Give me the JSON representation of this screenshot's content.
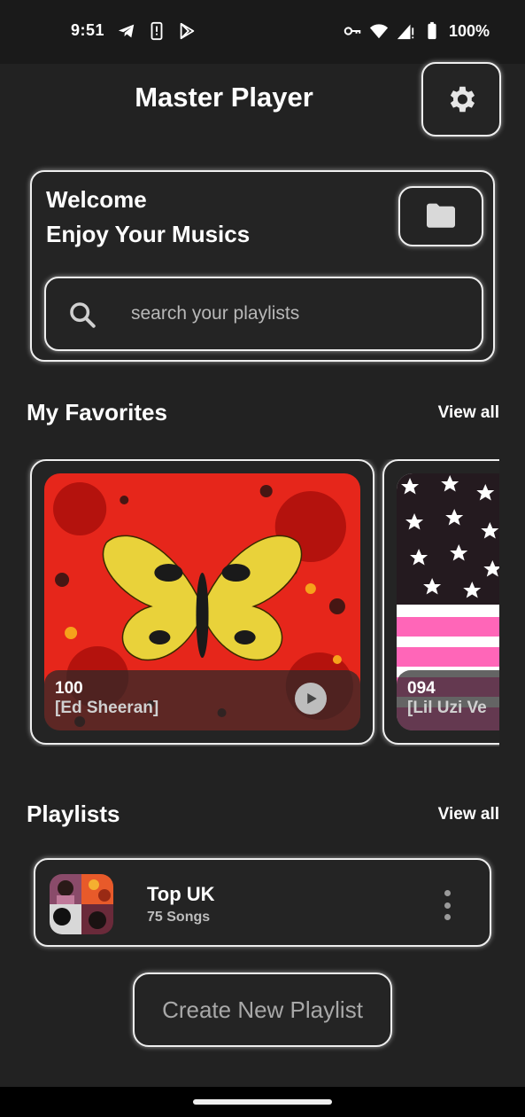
{
  "status_bar": {
    "time": "9:51",
    "left_icons": [
      "telegram-icon",
      "notification-alert-icon",
      "play-store-icon"
    ],
    "right_icons": [
      "vpn-key-icon",
      "wifi-icon",
      "signal-icon",
      "battery-icon"
    ],
    "battery": "100%"
  },
  "header": {
    "title": "Master Player",
    "settings_icon": "gear-icon"
  },
  "welcome": {
    "line1": "Welcome",
    "line2": "Enjoy Your Musics",
    "folder_icon": "folder-icon",
    "search_placeholder": "search your playlists"
  },
  "favorites": {
    "title": "My Favorites",
    "view_all": "View all",
    "items": [
      {
        "title": "100",
        "artist": "[Ed Sheeran]"
      },
      {
        "title": "094",
        "artist": "[Lil Uzi Ve"
      }
    ]
  },
  "playlists": {
    "title": "Playlists",
    "view_all": "View all",
    "items": [
      {
        "name": "Top UK",
        "count": "75 Songs"
      }
    ]
  },
  "create_button": "Create New Playlist",
  "colors": {
    "background": "#222222",
    "card_border": "#eeeeee",
    "text": "#ffffff",
    "muted_text": "#bdbdbd"
  }
}
